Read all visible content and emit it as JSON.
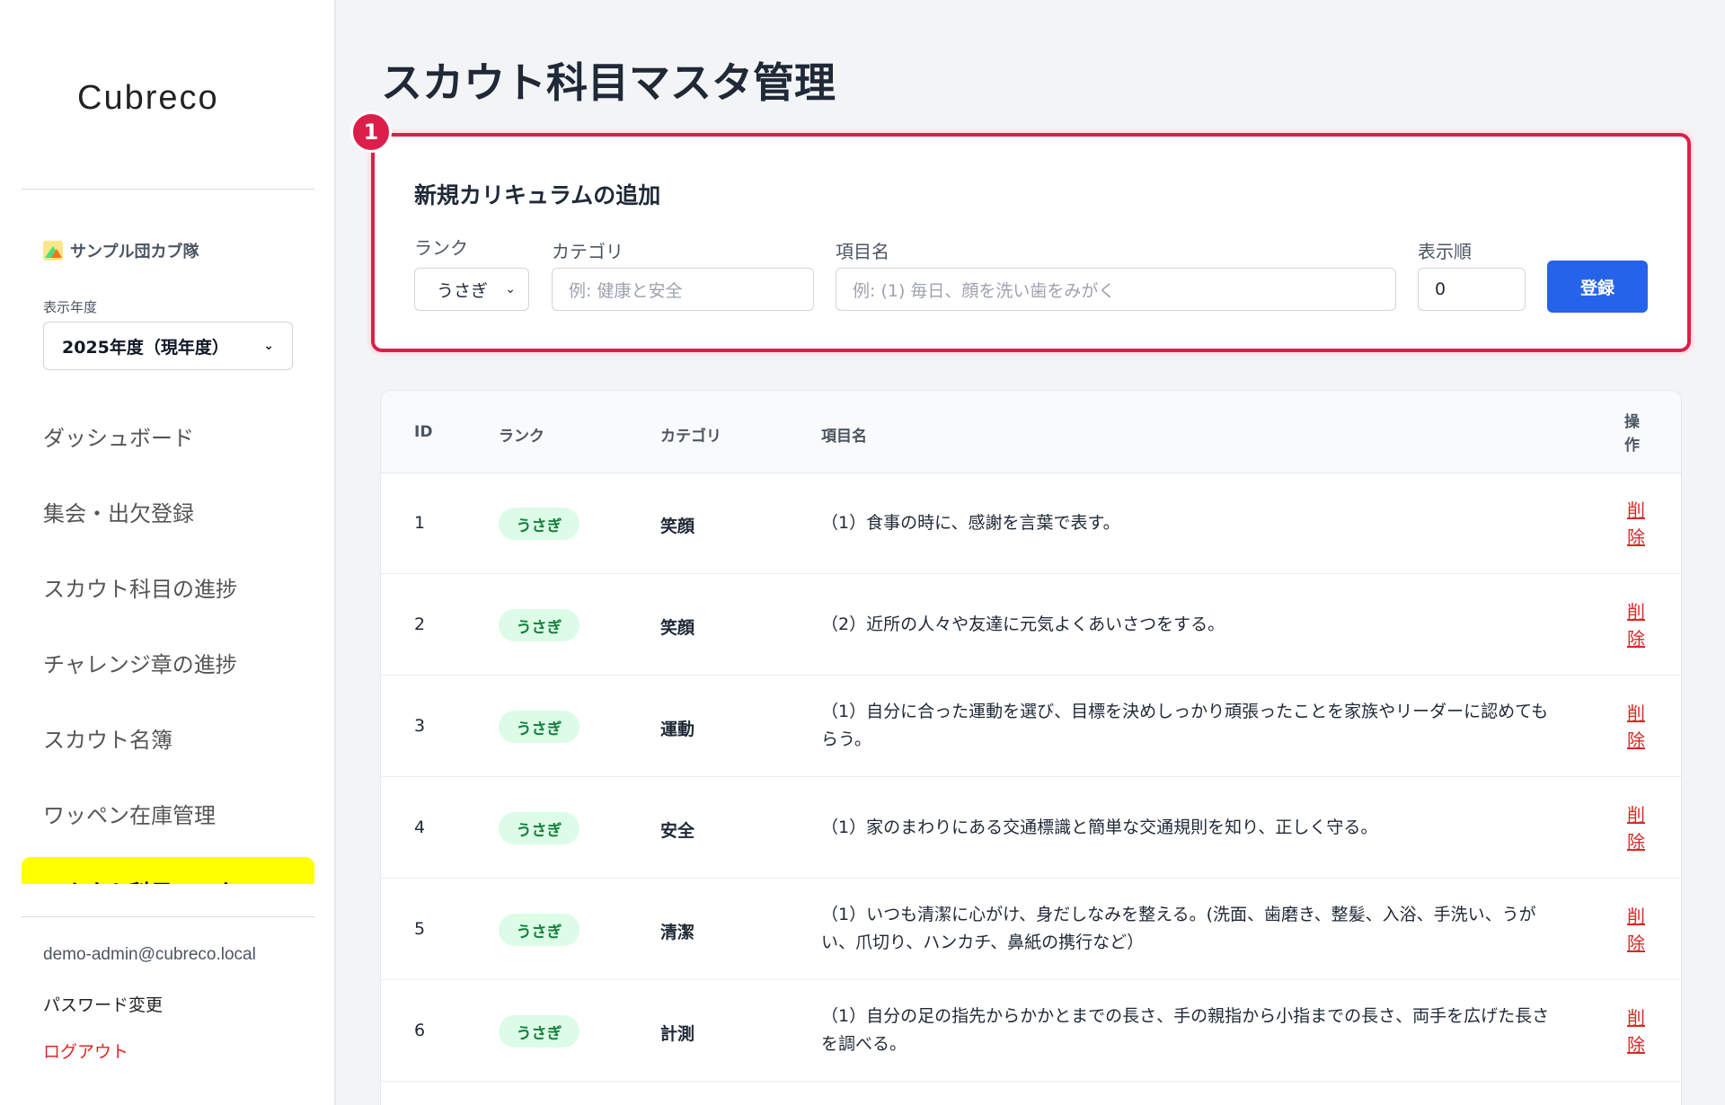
{
  "app": {
    "logo": "Cubreco"
  },
  "sidebar": {
    "org_name": "サンプル団カブ隊",
    "year_label": "表示年度",
    "year_value": "2025年度（現年度）",
    "nav": [
      {
        "label": "ダッシュボード"
      },
      {
        "label": "集会・出欠登録"
      },
      {
        "label": "スカウト科目の進捗"
      },
      {
        "label": "チャレンジ章の進捗"
      },
      {
        "label": "スカウト名簿"
      },
      {
        "label": "ワッペン在庫管理"
      },
      {
        "label": "スカウト科目マスタ"
      }
    ],
    "user_email": "demo-admin@cubreco.local",
    "password_link": "パスワード変更",
    "logout_link": "ログアウト"
  },
  "page": {
    "title": "スカウト科目マスタ管理"
  },
  "form": {
    "badge": "1",
    "title": "新規カリキュラムの追加",
    "rank_label": "ランク",
    "rank_value": "うさぎ",
    "category_label": "カテゴリ",
    "category_placeholder": "例: 健康と安全",
    "item_label": "項目名",
    "item_placeholder": "例: (1) 毎日、顔を洗い歯をみがく",
    "order_label": "表示順",
    "order_value": "0",
    "submit_label": "登録"
  },
  "table": {
    "headers": {
      "id": "ID",
      "rank": "ランク",
      "category": "カテゴリ",
      "item": "項目名",
      "action": "操作"
    },
    "rows": [
      {
        "id": "1",
        "rank": "うさぎ",
        "category": "笑顔",
        "item": "（1）食事の時に、感謝を言葉で表す。",
        "action": "削除"
      },
      {
        "id": "2",
        "rank": "うさぎ",
        "category": "笑顔",
        "item": "（2）近所の人々や友達に元気よくあいさつをする。",
        "action": "削除"
      },
      {
        "id": "3",
        "rank": "うさぎ",
        "category": "運動",
        "item": "（1）自分に合った運動を選び、目標を決めしっかり頑張ったことを家族やリーダーに認めてもらう。",
        "action": "削除"
      },
      {
        "id": "4",
        "rank": "うさぎ",
        "category": "安全",
        "item": "（1）家のまわりにある交通標識と簡単な交通規則を知り、正しく守る。",
        "action": "削除"
      },
      {
        "id": "5",
        "rank": "うさぎ",
        "category": "清潔",
        "item": "（1）いつも清潔に心がけ、身だしなみを整える。(洗面、歯磨き、整髪、入浴、手洗い、うがい、爪切り、ハンカチ、鼻紙の携行など）",
        "action": "削除"
      },
      {
        "id": "6",
        "rank": "うさぎ",
        "category": "計測",
        "item": "（1）自分の足の指先からかかとまでの長さ、手の親指から小指までの長さ、両手を広げた長さを調べる。",
        "action": "削除"
      }
    ]
  },
  "colors": {
    "accent": "#dc1f4a",
    "primary_button": "#2563eb",
    "active_nav": "#ffff00",
    "rank_pill_bg": "#dcfce7",
    "rank_pill_text": "#15803d",
    "delete_link": "#dc2626"
  },
  "icons": {
    "org": "camp-icon",
    "year_select": "chevron-down-icon",
    "rank_select": "chevron-down-icon"
  }
}
